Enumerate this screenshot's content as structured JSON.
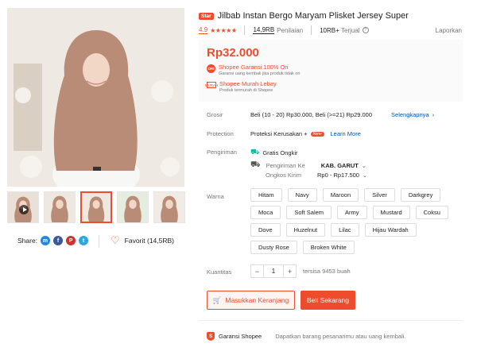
{
  "product": {
    "badge": "Star",
    "title": "Jilbab Instan Bergo Maryam Plisket Jersey Super",
    "rating": "4.9",
    "stars": "★★★★★",
    "review_count": "14,9RB",
    "review_label": "Penilaian",
    "sold_count": "10RB+",
    "sold_label": "Terjual",
    "report_label": "Laporkan",
    "info_icon": "?"
  },
  "price": {
    "value": "Rp32.000",
    "guarantee_icon": "ORI",
    "guarantee_title": "Shopee Garansi 100% Ori",
    "guarantee_sub": "Garansi uang kembali jika produk tidak ori",
    "cheap_icon": "MURAH",
    "cheap_title": "Shopee Murah Lebay",
    "cheap_sub": "Produk termurah di Shopee"
  },
  "grosir": {
    "label": "Grosir",
    "text": "Beli (10 - 20) Rp30.000, Beli (>=21) Rp29.000",
    "link": "Selengkapnya",
    "chevron": "›"
  },
  "protection": {
    "label": "Protection",
    "text": "Proteksi Kerusakan +",
    "badge": "New",
    "link": "Learn More"
  },
  "shipping": {
    "label": "Pengiriman",
    "free_icon": "⛟",
    "free_label": "Gratis Ongkir",
    "to_icon": "⛟",
    "to_label": "Pengiriman Ke",
    "to_value": "KAB. GARUT",
    "cost_label": "Ongkos Kirim",
    "cost_value": "Rp0 - Rp17.500",
    "chevron": "⌄"
  },
  "variant": {
    "label": "Warna",
    "options": [
      "Hitam",
      "Navy",
      "Maroon",
      "Silver",
      "Darkgrey",
      "Moca",
      "Soft Salem",
      "Army",
      "Mustard",
      "Coksu",
      "Dove",
      "Huzelnut",
      "Lilac",
      "Hijau Wardah",
      "Dusty Rose",
      "Broken White"
    ]
  },
  "quantity": {
    "label": "Kuantitas",
    "minus": "−",
    "value": "1",
    "plus": "+",
    "stock": "tersisa 9453 buah"
  },
  "actions": {
    "cart_icon": "🛒",
    "cart_label": "Masukkan Keranjang",
    "buy_label": "Beli Sekarang"
  },
  "footer": {
    "shield_icon": "S",
    "guarantee": "Garansi Shopee",
    "desc": "Dapatkan barang pesananmu atau uang kembali."
  },
  "share": {
    "label": "Share:",
    "messenger": "m",
    "facebook": "f",
    "pinterest": "P",
    "twitter": "t"
  },
  "favorite": {
    "icon": "♡",
    "label": "Favorit (14,5RB)"
  },
  "colors": {
    "accent": "#ee4d2d",
    "hijab": "#b98c78",
    "messenger": "#1e88e5",
    "facebook": "#3b5998",
    "pinterest": "#d32f2f",
    "twitter": "#29a9e1"
  }
}
